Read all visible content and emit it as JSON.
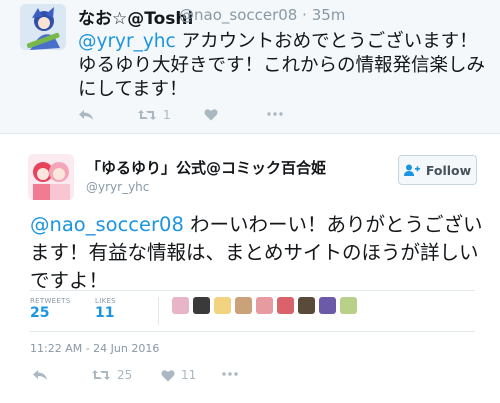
{
  "reply_tweet": {
    "display_name": "なお☆@Toshi",
    "handle": "@nao_soccer08",
    "separator": "·",
    "time": "35m",
    "mention": "@yryr_yhc",
    "text": " アカウントおめでとうございます！ゆるゆり大好きです！これからの情報発信楽しみにしてます！",
    "actions": {
      "retweet_count": "1"
    }
  },
  "main_tweet": {
    "display_name": "「ゆるゆり」公式@コミック百合姫",
    "handle": "@yryr_yhc",
    "follow_label": "Follow",
    "mention": "@nao_soccer08",
    "text": " わーいわーい！ありがとうございます！有益な情報は、まとめサイトのほうが詳しいですよ！",
    "stats": {
      "retweets_label": "RETWEETS",
      "retweets_value": "25",
      "likes_label": "LIKES",
      "likes_value": "11"
    },
    "liker_colors": [
      "#e8b4c8",
      "#3a3a3a",
      "#f2d480",
      "#c9a27a",
      "#e79aa0",
      "#d9626b",
      "#5a4a3a",
      "#6b5aa8",
      "#b8d088"
    ],
    "timestamp": "11:22 AM - 24 Jun 2016",
    "actions": {
      "retweet_count": "25",
      "like_count": "11"
    }
  },
  "colors": {
    "link": "#1b95e0",
    "muted": "#8899a6",
    "icon": "#aab8c2",
    "reply_bg": "#f5f8fa"
  }
}
